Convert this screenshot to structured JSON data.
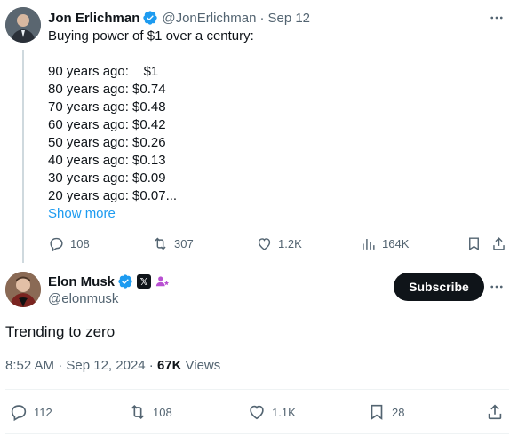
{
  "quoted_tweet": {
    "author_name": "Jon Erlichman",
    "handle": "@JonErlichman",
    "date": "Sep 12",
    "body_lines": [
      "Buying power of $1 over a century:",
      "",
      "90 years ago:    $1",
      "80 years ago: $0.74",
      "70 years ago: $0.48",
      "60 years ago: $0.42",
      "50 years ago: $0.26",
      "40 years ago: $0.13",
      "30 years ago: $0.09",
      "20 years ago: $0.07..."
    ],
    "show_more": "Show more",
    "actions": {
      "replies": "108",
      "reposts": "307",
      "likes": "1.2K",
      "views": "164K"
    }
  },
  "main_tweet": {
    "author_name": "Elon Musk",
    "handle": "@elonmusk",
    "subscribe_label": "Subscribe",
    "text": "Trending to zero",
    "time": "8:52 AM",
    "date": "Sep 12, 2024",
    "views_count": "67K",
    "views_label": "Views",
    "actions": {
      "replies": "112",
      "reposts": "108",
      "likes": "1.1K",
      "bookmarks": "28"
    }
  },
  "colors": {
    "verified_blue": "#1d9bf0",
    "link_blue": "#1d9bf0",
    "muted_text": "#536471",
    "primary_text": "#0f1419",
    "moderator_purple": "#b84fd1"
  },
  "icons": {
    "reply": "speech-bubble-icon",
    "repost": "repost-arrows-icon",
    "like": "heart-icon",
    "views": "bar-chart-icon",
    "bookmark": "bookmark-icon",
    "share": "share-upload-icon",
    "more": "more-dots-icon",
    "verified": "verified-badge-icon",
    "x_affiliate": "x-logo-icon",
    "moderator": "moderator-person-icon"
  }
}
